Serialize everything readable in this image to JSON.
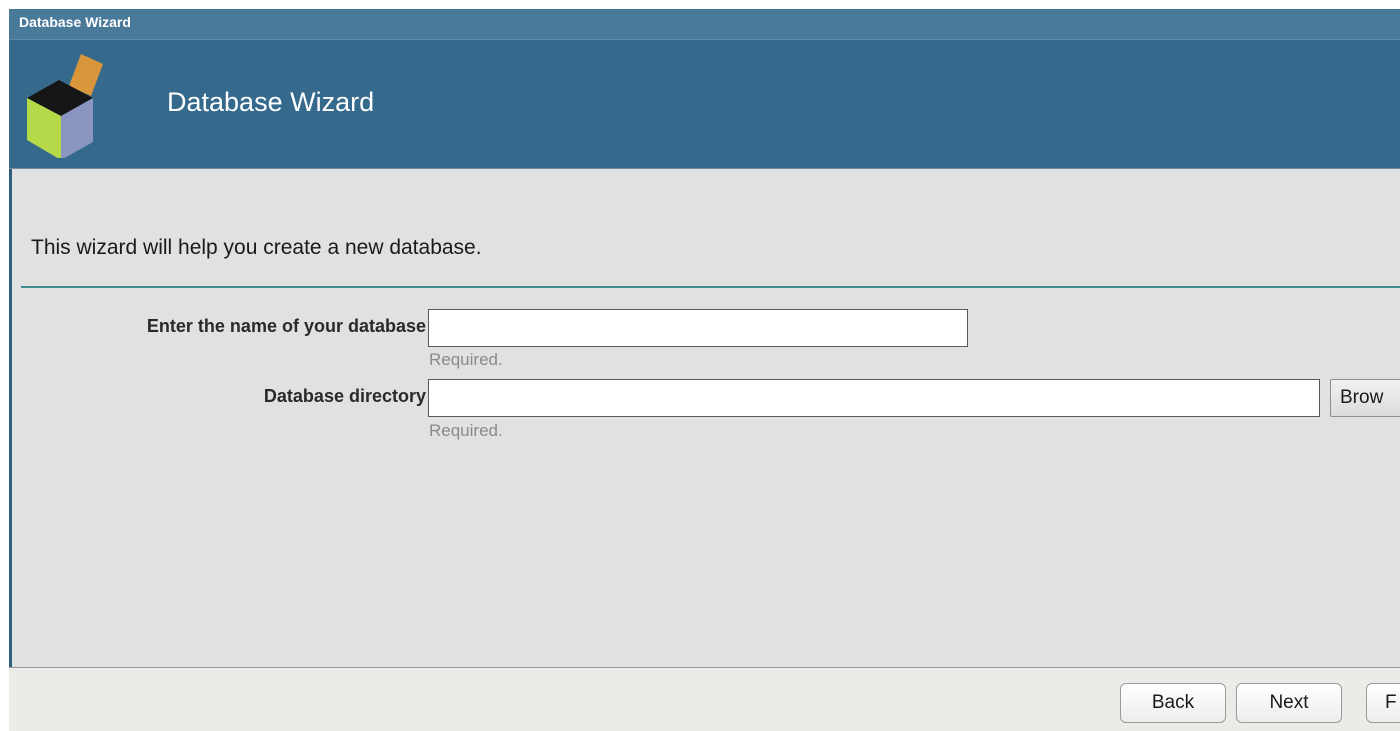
{
  "window": {
    "title": "Database Wizard"
  },
  "banner": {
    "title": "Database Wizard",
    "logo_icon": "cube-box-icon"
  },
  "content": {
    "intro": "This wizard will help you create a new database.",
    "fields": {
      "name": {
        "label": "Enter the name of your database",
        "value": "",
        "placeholder": "",
        "hint": "Required."
      },
      "directory": {
        "label": "Database directory",
        "value": "",
        "placeholder": "",
        "hint": "Required.",
        "browse_label": "Brow"
      }
    }
  },
  "footer": {
    "back_label": "Back",
    "next_label": "Next",
    "finish_label": "F"
  },
  "colors": {
    "titlebar": "#4a7a9a",
    "banner": "#356a8c",
    "content_bg": "#e1e1e1",
    "divider": "#3c8c8c",
    "hint_text": "#8a8a8a"
  }
}
